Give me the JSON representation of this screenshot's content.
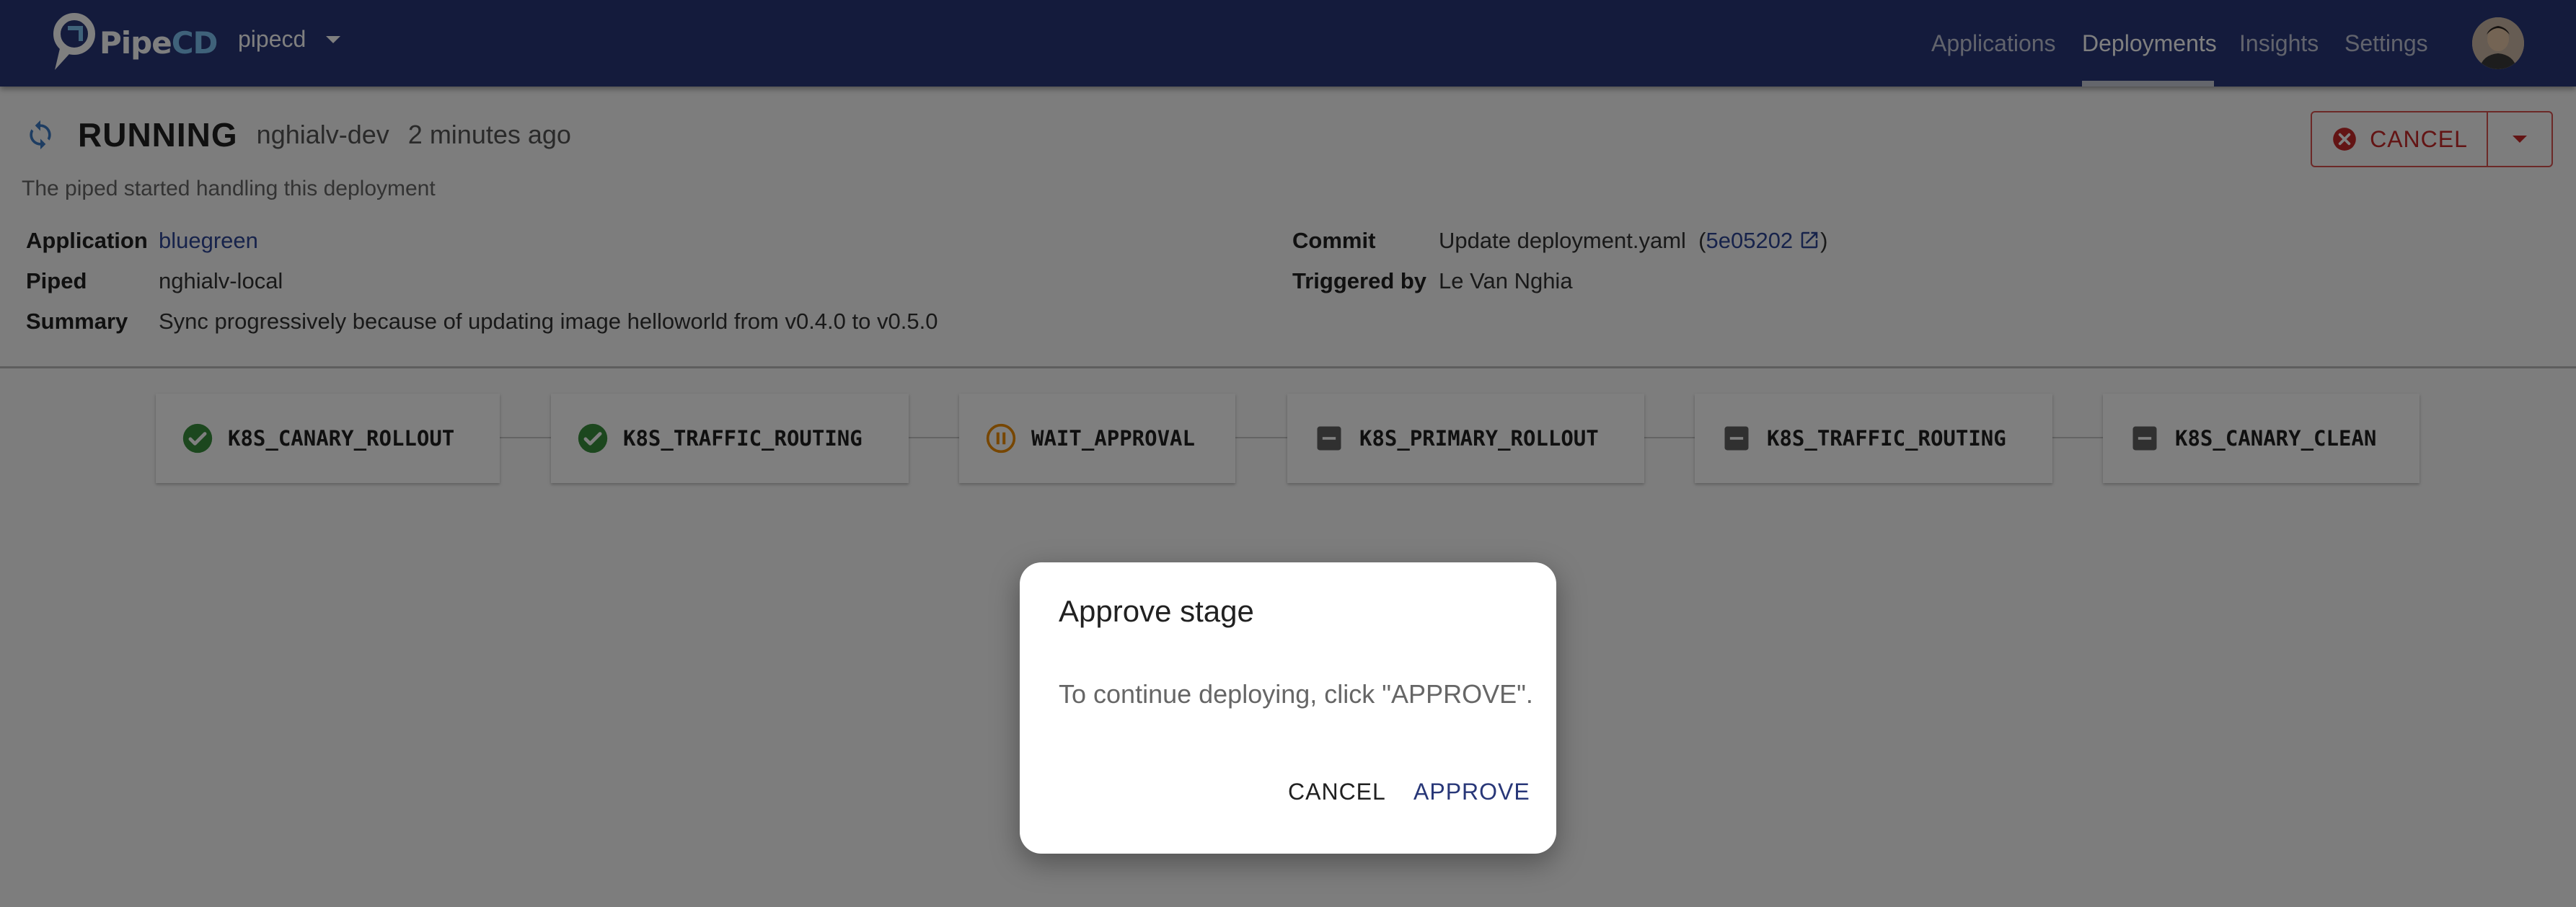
{
  "app": {
    "logo_text_a": "Pipe",
    "logo_text_b": "CD",
    "project": "pipecd",
    "nav": [
      "Applications",
      "Deployments",
      "Insights",
      "Settings"
    ],
    "active_nav": "Deployments"
  },
  "deployment": {
    "status": "RUNNING",
    "env": "nghialv-dev",
    "time": "2 minutes ago",
    "description": "The piped started handling this deployment",
    "cancel_label": "CANCEL",
    "labels": {
      "application": "Application",
      "piped": "Piped",
      "summary": "Summary",
      "commit": "Commit",
      "triggered_by": "Triggered by"
    },
    "values": {
      "application": "bluegreen",
      "piped": "nghialv-local",
      "summary": "Sync progressively because of updating image helloworld from v0.4.0 to v0.5.0",
      "commit_message": "Update deployment.yaml",
      "commit_open": "(",
      "commit_hash": "5e05202",
      "commit_close": ")",
      "triggered_by": "Le Van Nghia"
    }
  },
  "stages": [
    {
      "name": "K8S_CANARY_ROLLOUT",
      "status": "success",
      "icon": "check-circle-icon"
    },
    {
      "name": "K8S_TRAFFIC_ROUTING",
      "status": "success",
      "icon": "check-circle-icon"
    },
    {
      "name": "WAIT_APPROVAL",
      "status": "paused",
      "icon": "pause-circle-icon"
    },
    {
      "name": "K8S_PRIMARY_ROLLOUT",
      "status": "not-started",
      "icon": "minus-box-icon"
    },
    {
      "name": "K8S_TRAFFIC_ROUTING",
      "status": "not-started",
      "icon": "minus-box-icon"
    },
    {
      "name": "K8S_CANARY_CLEAN",
      "status": "not-started",
      "icon": "minus-box-icon"
    }
  ],
  "dialog": {
    "title": "Approve stage",
    "body": "To continue deploying, click \"APPROVE\".",
    "cancel_label": "CANCEL",
    "approve_label": "APPROVE"
  },
  "colors": {
    "appbar": "#283778",
    "success": "#388e3c",
    "paused": "#ef8c00",
    "not_started": "#616161",
    "cancel": "#c62828",
    "link": "#2f4696"
  }
}
